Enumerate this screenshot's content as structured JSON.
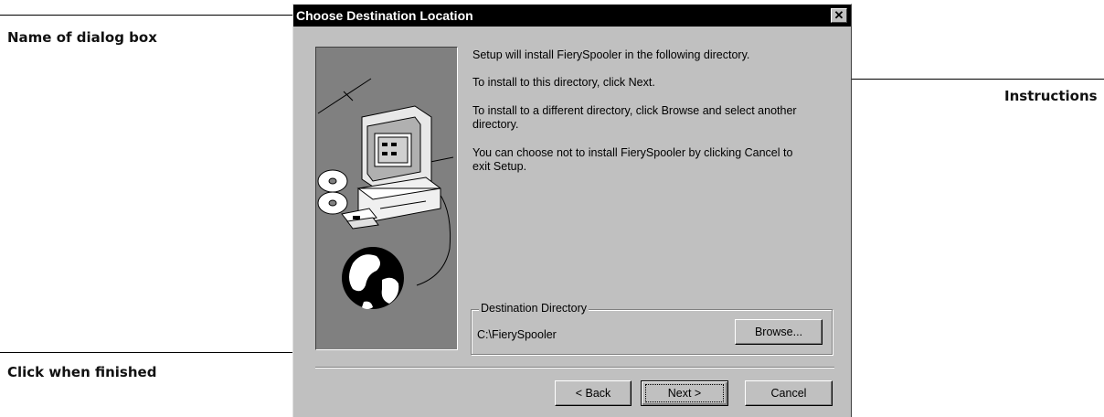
{
  "callouts": {
    "name_of_dialog": "Name of dialog box",
    "instructions": "Instructions",
    "click_when_finished": "Click when finished"
  },
  "dialog": {
    "title": "Choose Destination Location",
    "close_glyph": "✕",
    "instructions": [
      "Setup will install FierySpooler in the following directory.",
      "To install to this directory, click Next.",
      "To install to a different directory, click Browse and select another",
      "directory.",
      "You can choose not to install FierySpooler by clicking Cancel to",
      "exit Setup."
    ],
    "destination_group_label": "Destination Directory",
    "destination_path": "C:\\FierySpooler",
    "browse_label": "Browse...",
    "back_label": "< Back",
    "next_label": "Next >",
    "cancel_label": "Cancel"
  },
  "icons": [
    "computer-monitor-icon",
    "cd-disc-icon",
    "floppy-disk-icon",
    "globe-icon"
  ],
  "colors": {
    "titlebar_bg": "#000000",
    "dialog_bg": "#c0c0c0",
    "art_bg": "#808080"
  }
}
